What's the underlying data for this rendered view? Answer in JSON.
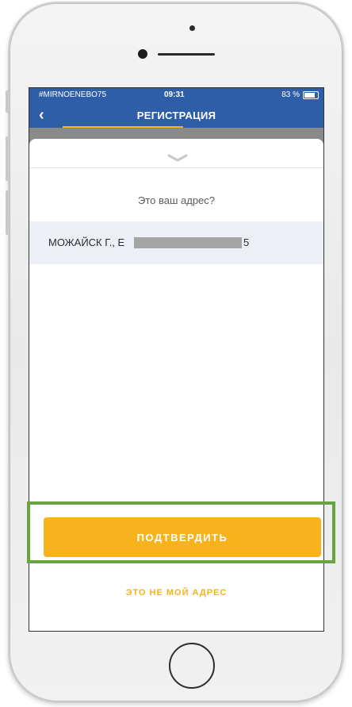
{
  "status_bar": {
    "carrier": "#MIRNOENEBO75",
    "time": "09:31",
    "battery": "83 %"
  },
  "nav": {
    "back_icon": "chevron-left",
    "title": "РЕГИСТРАЦИЯ"
  },
  "sheet": {
    "question": "Это ваш адрес?",
    "address": {
      "prefix": "МОЖАЙСК Г., Е",
      "suffix": "5"
    },
    "confirm_label": "ПОДТВЕРДИТЬ",
    "not_mine_label": "ЭТО НЕ МОЙ АДРЕС"
  },
  "colors": {
    "navbar": "#2f5ea8",
    "accent": "#f7b21c",
    "highlight": "#6aa342",
    "address_bg": "#ecf0f6"
  }
}
